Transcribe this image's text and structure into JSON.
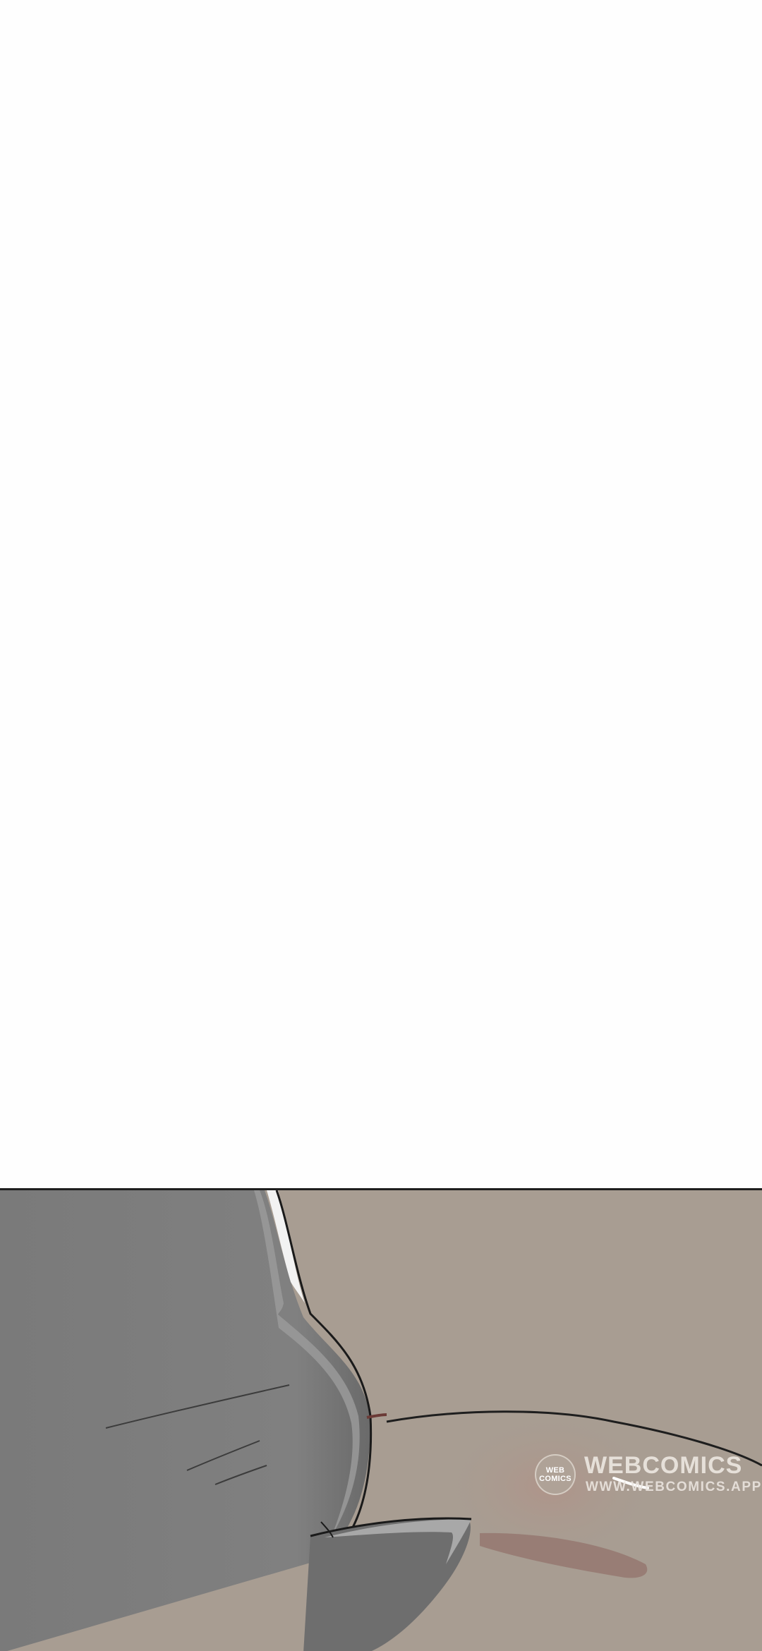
{
  "watermark": {
    "badge_line1": "WEB",
    "badge_line2": "COMICS",
    "title": "WEBCOMICS",
    "url": "WWW.WEBCOMICS.APP"
  },
  "colors": {
    "page_background": "#ffffff",
    "panel_background": "#a89d92",
    "creature_gray": "#7d7d7d",
    "panel_border": "#1e1e1e"
  }
}
